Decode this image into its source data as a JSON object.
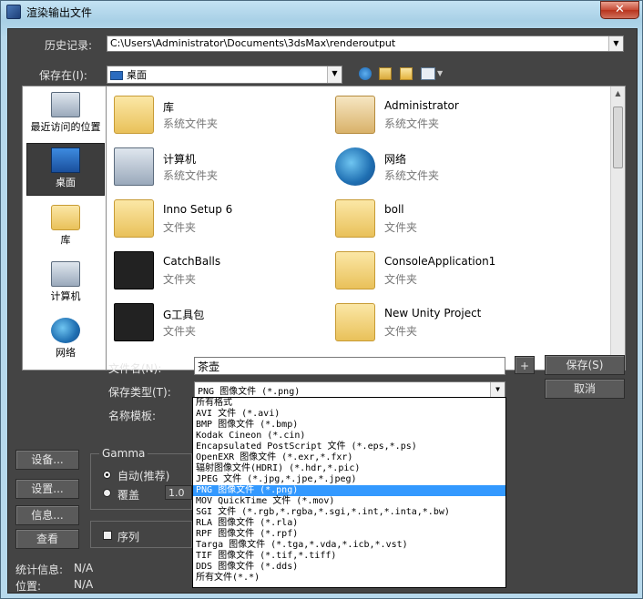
{
  "window": {
    "title": "渲染输出文件",
    "close_glyph": "✕"
  },
  "history": {
    "label": "历史记录:",
    "value": "C:\\Users\\Administrator\\Documents\\3dsMax\\renderoutput"
  },
  "save_in": {
    "label": "保存在(I):",
    "value": "桌面"
  },
  "places": [
    {
      "label": "最近访问的位置",
      "icon": "recent-icon"
    },
    {
      "label": "桌面",
      "icon": "desktop-icon"
    },
    {
      "label": "库",
      "icon": "library-icon"
    },
    {
      "label": "计算机",
      "icon": "computer-icon"
    },
    {
      "label": "网络",
      "icon": "network-icon"
    }
  ],
  "files": [
    {
      "name": "库",
      "type": "系统文件夹",
      "icon": "library-folder-icon"
    },
    {
      "name": "Administrator",
      "type": "系统文件夹",
      "icon": "user-folder-icon"
    },
    {
      "name": "计算机",
      "type": "系统文件夹",
      "icon": "computer-icon"
    },
    {
      "name": "网络",
      "type": "系统文件夹",
      "icon": "network-icon"
    },
    {
      "name": "Inno Setup 6",
      "type": "文件夹",
      "icon": "folder-icon"
    },
    {
      "name": "boll",
      "type": "文件夹",
      "icon": "folder-icon"
    },
    {
      "name": "CatchBalls",
      "type": "文件夹",
      "icon": "unity-folder-icon"
    },
    {
      "name": "ConsoleApplication1",
      "type": "文件夹",
      "icon": "vs-folder-icon"
    },
    {
      "name": "G工具包",
      "type": "文件夹",
      "icon": "unity-folder-icon"
    },
    {
      "name": "New Unity Project",
      "type": "文件夹",
      "icon": "folder-icon"
    }
  ],
  "filename": {
    "label": "文件名(N):",
    "value": "茶壶"
  },
  "filetype": {
    "label": "保存类型(T):",
    "value": "PNG 图像文件 (*.png)"
  },
  "name_template": {
    "label": "名称模板:"
  },
  "buttons": {
    "plus": "+",
    "save": "保存(S)",
    "cancel": "取消"
  },
  "type_options": [
    "所有格式",
    "AVI 文件 (*.avi)",
    "BMP 图像文件 (*.bmp)",
    "Kodak Cineon (*.cin)",
    "Encapsulated PostScript 文件 (*.eps,*.ps)",
    "OpenEXR 图像文件 (*.exr,*.fxr)",
    "辐射图像文件(HDRI) (*.hdr,*.pic)",
    "JPEG 文件 (*.jpg,*.jpe,*.jpeg)",
    "PNG 图像文件 (*.png)",
    "MOV QuickTime 文件 (*.mov)",
    "SGI 文件 (*.rgb,*.rgba,*.sgi,*.int,*.inta,*.bw)",
    "RLA 图像文件 (*.rla)",
    "RPF 图像文件 (*.rpf)",
    "Targa 图像文件 (*.tga,*.vda,*.icb,*.vst)",
    "TIF 图像文件 (*.tif,*.tiff)",
    "DDS 图像文件 (*.dds)",
    "所有文件(*.*)"
  ],
  "selected_type_index": 8,
  "left_buttons": {
    "setup": "设备...",
    "settings": "设置...",
    "info": "信息...",
    "view": "查看"
  },
  "gamma": {
    "title": "Gamma",
    "auto": "自动(推荐)",
    "override": "覆盖",
    "override_value": "1.0"
  },
  "sequence": {
    "label": "序列"
  },
  "stats": {
    "label": "统计信息:",
    "value": "N/A"
  },
  "location": {
    "label": "位置:",
    "value": "N/A"
  }
}
